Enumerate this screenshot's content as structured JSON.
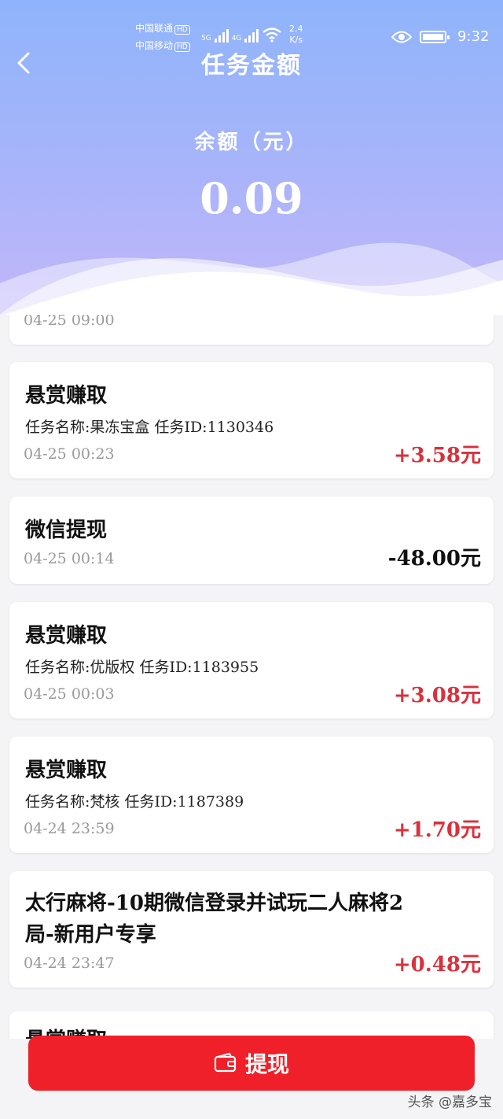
{
  "status_bar": {
    "carrier1": "中国联通",
    "carrier2": "中国移动",
    "hd": "HD",
    "net1": "5G",
    "net2": "4G",
    "speed_value": "2.4",
    "speed_unit": "K/s",
    "time": "9:32"
  },
  "header": {
    "title": "任务金额",
    "balance_label": "余额（元）",
    "balance_value": "0.09"
  },
  "records": [
    {
      "time": "04-25 09:00"
    },
    {
      "name": "悬赏赚取",
      "info": "任务名称:果冻宝盒  任务ID:1130346",
      "time": "04-25 00:23",
      "amount": "+3.58元"
    },
    {
      "name": "微信提现",
      "time": "04-25 00:14",
      "amount": "-48.00元"
    },
    {
      "name": "悬赏赚取",
      "info": "任务名称:优版权  任务ID:1183955",
      "time": "04-25 00:03",
      "amount": "+3.08元"
    },
    {
      "name": "悬赏赚取",
      "info": "任务名称:梵核  任务ID:1187389",
      "time": "04-24 23:59",
      "amount": "+1.70元"
    },
    {
      "name_line1": "太行麻将-10期微信登录并试玩二人麻将2",
      "name_line2": "局-新用户专享",
      "time": "04-24 23:47",
      "amount": "+0.48元"
    },
    {
      "name": "悬赏赚取"
    }
  ],
  "withdraw_button": {
    "label": "提现"
  },
  "watermark": "头条 @嘉多宝",
  "colors": {
    "accent": "#f0202a",
    "positive": "#d8323c",
    "header_top": "#8fb4fb",
    "header_bottom": "#c2b6f9"
  }
}
